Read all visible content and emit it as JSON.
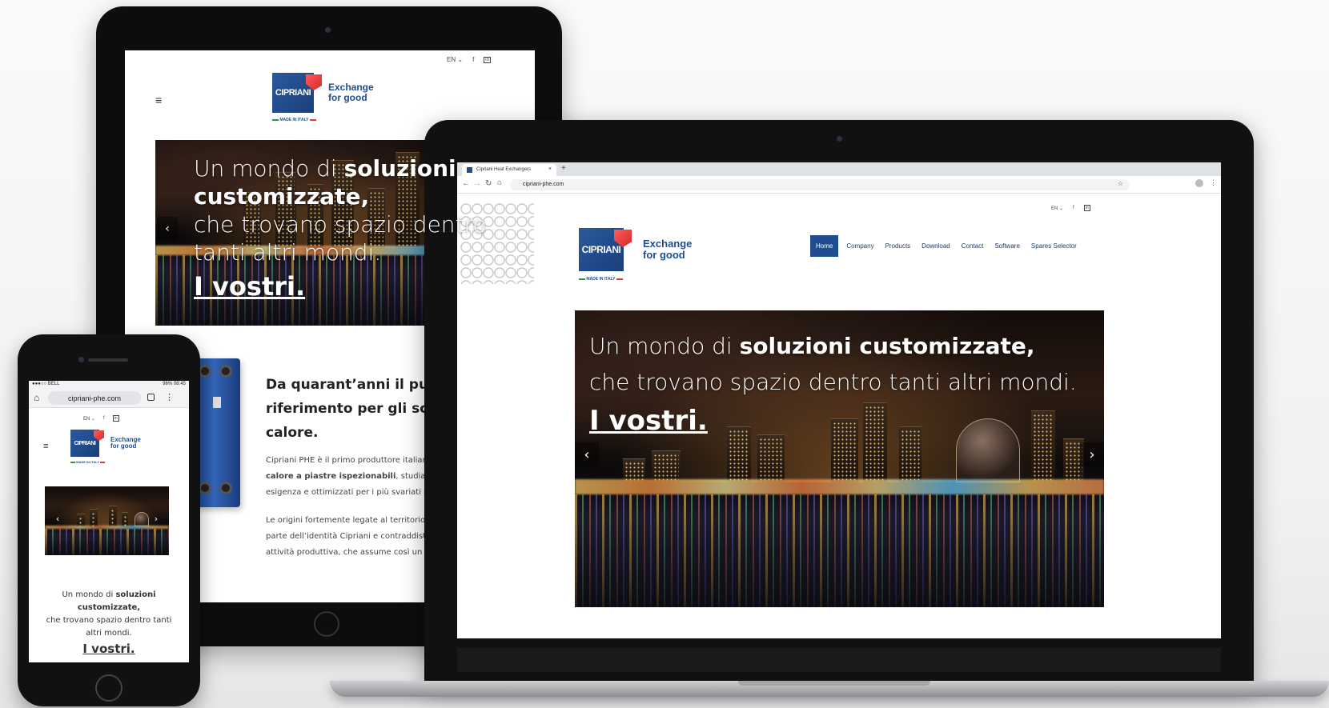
{
  "brand": {
    "logo_text": "CIPRIANI",
    "tagline_1": "Exchange",
    "tagline_2": "for good",
    "made_in": "MADE IN ITALY"
  },
  "colors": {
    "brand_blue": "#1f4d8f",
    "brand_red": "#e33b3b",
    "nav_active": "#1f4d8f"
  },
  "browser": {
    "tab_title": "Cipriani Heat Exchangers",
    "new_tab": "+",
    "url": "cipriani-phe.com"
  },
  "lang": "EN",
  "social": {
    "facebook_icon": "f",
    "linkedin_icon": "in"
  },
  "nav": {
    "items": [
      {
        "label": "Home",
        "active": true
      },
      {
        "label": "Company",
        "active": false
      },
      {
        "label": "Products",
        "active": false
      },
      {
        "label": "Download",
        "active": false
      },
      {
        "label": "Contact",
        "active": false
      },
      {
        "label": "Software",
        "active": false
      },
      {
        "label": "Spares Selector",
        "active": false
      }
    ]
  },
  "hero": {
    "line1_pre": "Un mondo di ",
    "line1_bold": "soluzioni customizzate,",
    "line2": "che trovano spazio dentro tanti altri mondi.",
    "cta": "I vostri."
  },
  "tablet": {
    "hero_line1_pre": "Un mondo di ",
    "hero_line1_bold": "soluzioni",
    "hero_line2_bold": "customizzate,",
    "hero_line3": "che trovano spazio dentro",
    "hero_line4": "tanti altri mondi.",
    "cta": "I vostri.",
    "section_heading_1": "Da quarant’anni il punto di",
    "section_heading_2": "riferimento per gli scambiatori di",
    "section_heading_3": "calore.",
    "para1_line1": "Cipriani PHE è il primo produttore italiano di scambiatori di",
    "para1_line2_bold": "calore a piastre ispezionabili",
    "para1_line2_rest": ", studiati per soddisfare ogni",
    "para1_line3": "esigenza e ottimizzati per i più svariati settori",
    "para2_line1": "Le origini fortemente legate al territorio sono",
    "para2_line2": "parte dell’identità Cipriani e contraddistinguono la sua",
    "para2_line3": "attività produttiva, che assume così un carattere"
  },
  "phone": {
    "status_left": "●●●○○ BELL",
    "status_right": "96% 08:45",
    "url": "cipriani-phe.com",
    "hero_line1_pre": "Un mondo di ",
    "hero_line1_bold": "soluzioni",
    "hero_line2_bold": "customizzate,",
    "hero_line3": "che trovano spazio dentro tanti",
    "hero_line4": "altri mondi.",
    "cta": "I vostri."
  }
}
